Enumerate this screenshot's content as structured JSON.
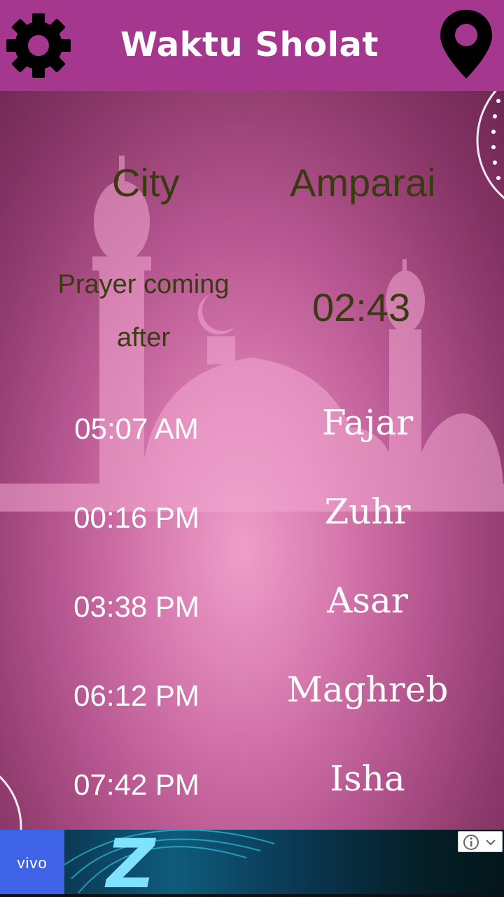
{
  "app": {
    "title": "Waktu Sholat"
  },
  "city": {
    "label": "City",
    "value": "Amparai"
  },
  "next_prayer": {
    "label": "Prayer coming after",
    "countdown": "02:43"
  },
  "prayers": [
    {
      "time": "05:07 AM",
      "name": "Fajar"
    },
    {
      "time": "00:16 PM",
      "name": "Zuhr"
    },
    {
      "time": "03:38 PM",
      "name": "Asar"
    },
    {
      "time": "06:12 PM",
      "name": "Maghreb"
    },
    {
      "time": "07:42 PM",
      "name": "Isha"
    }
  ],
  "ad": {
    "brand": "vivo",
    "graphic": "Z"
  },
  "icons": {
    "settings": "gear-icon",
    "location": "map-pin-icon",
    "ad_info": "info-icon",
    "ad_menu": "chevron-down-icon"
  },
  "colors": {
    "appbar": "#a6378f",
    "dark_text": "#3a3a12",
    "light_text": "#ffffff"
  }
}
